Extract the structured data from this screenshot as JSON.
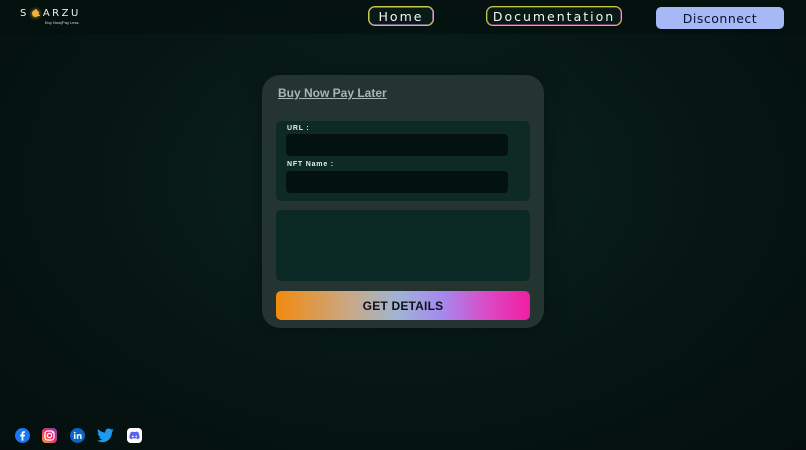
{
  "brand": {
    "name": "S LARZU",
    "tagline": "Buy Now|Pay Less"
  },
  "nav": {
    "home": "Home",
    "documentation": "Documentation",
    "disconnect": "Disconnect"
  },
  "form": {
    "title": "Buy Now Pay Later",
    "url_label": "URL  :",
    "url_value": "",
    "nft_label": "NFT  Name :",
    "nft_value": "",
    "submit": "GET DETAILS"
  },
  "social_icons": [
    "facebook-icon",
    "instagram-icon",
    "linkedin-icon",
    "twitter-icon",
    "discord-icon"
  ],
  "colors": {
    "accent_disconnect": "#a6b8f6",
    "nav_border": "#c7c94a",
    "card_bg": "#233431"
  }
}
